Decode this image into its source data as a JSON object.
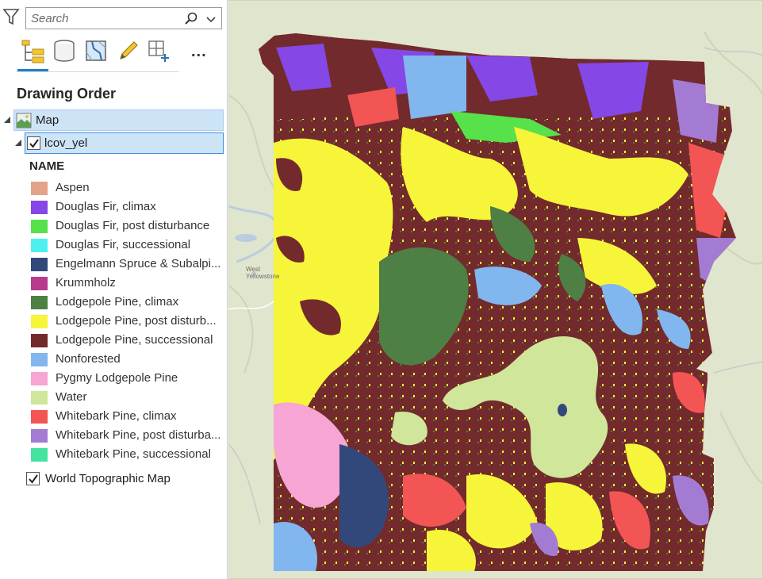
{
  "search": {
    "placeholder": "Search",
    "value": ""
  },
  "toolbar": {
    "tabs": [
      {
        "name": "list-by-drawing-order",
        "icon": "drawing-order-icon"
      },
      {
        "name": "list-by-data-source",
        "icon": "database-icon"
      },
      {
        "name": "list-by-selection",
        "icon": "selection-icon"
      },
      {
        "name": "list-by-editing",
        "icon": "pencil-icon"
      },
      {
        "name": "list-by-snapping",
        "icon": "snapping-icon"
      }
    ],
    "more_label": "..."
  },
  "section_title": "Drawing Order",
  "tree": {
    "map_label": "Map",
    "layer_label": "lcov_yel",
    "layer_checked": true,
    "legend_heading": "NAME",
    "legend": [
      {
        "label": "Aspen",
        "color": "#e3a38a"
      },
      {
        "label": "Douglas Fir, climax",
        "color": "#8547e6"
      },
      {
        "label": "Douglas Fir, post disturbance",
        "color": "#57e14b"
      },
      {
        "label": "Douglas Fir, successional",
        "color": "#4cf0f0"
      },
      {
        "label": "Engelmann Spruce & Subalpi...",
        "color": "#33487a"
      },
      {
        "label": "Krummholz",
        "color": "#b83a8e"
      },
      {
        "label": "Lodgepole Pine, climax",
        "color": "#4e7f45"
      },
      {
        "label": "Lodgepole Pine, post disturb...",
        "color": "#f6f53a"
      },
      {
        "label": "Lodgepole Pine, successional",
        "color": "#732a2c"
      },
      {
        "label": "Nonforested",
        "color": "#82b6ee"
      },
      {
        "label": "Pygmy Lodgepole Pine",
        "color": "#f6a5d5"
      },
      {
        "label": "Water",
        "color": "#cfe69b"
      },
      {
        "label": "Whitebark Pine, climax",
        "color": "#f35454"
      },
      {
        "label": "Whitebark Pine, post disturba...",
        "color": "#a37bd3"
      },
      {
        "label": "Whitebark Pine, successional",
        "color": "#44e39f"
      }
    ],
    "basemap_label": "World Topographic Map",
    "basemap_checked": true
  },
  "map": {
    "place_label_1": "West",
    "place_label_2": "Yellowstone"
  }
}
